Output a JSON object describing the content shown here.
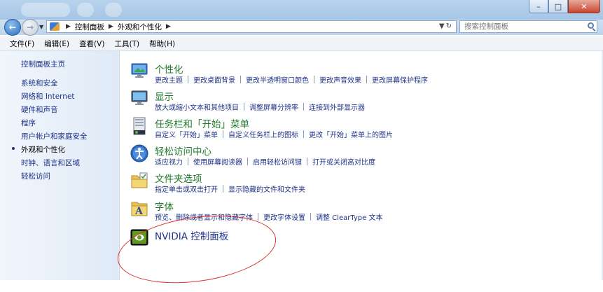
{
  "address": {
    "crumbs": [
      "控制面板",
      "外观和个性化"
    ]
  },
  "search": {
    "placeholder": "搜索控制面板"
  },
  "menu": [
    "文件(F)",
    "编辑(E)",
    "查看(V)",
    "工具(T)",
    "帮助(H)"
  ],
  "sidebar": {
    "home": "控制面板主页",
    "items": [
      "系统和安全",
      "网络和 Internet",
      "硬件和声音",
      "程序",
      "用户帐户和家庭安全",
      "外观和个性化",
      "时钟、语言和区域",
      "轻松访问"
    ],
    "active_index": 5
  },
  "categories": [
    {
      "title": "个性化",
      "icon": "personalization-icon",
      "links": [
        "更改主题",
        "更改桌面背景",
        "更改半透明窗口颜色",
        "更改声音效果",
        "更改屏幕保护程序"
      ]
    },
    {
      "title": "显示",
      "icon": "display-icon",
      "links": [
        "放大或缩小文本和其他项目",
        "调整屏幕分辨率",
        "连接到外部显示器"
      ]
    },
    {
      "title": "任务栏和「开始」菜单",
      "icon": "taskbar-icon",
      "links": [
        "自定义「开始」菜单",
        "自定义任务栏上的图标",
        "更改「开始」菜单上的图片"
      ]
    },
    {
      "title": "轻松访问中心",
      "icon": "ease-of-access-icon",
      "links": [
        "适应视力",
        "使用屏幕阅读器",
        "启用轻松访问键",
        "打开或关闭高对比度"
      ]
    },
    {
      "title": "文件夹选项",
      "icon": "folder-options-icon",
      "links": [
        "指定单击或双击打开",
        "显示隐藏的文件和文件夹"
      ]
    },
    {
      "title": "字体",
      "icon": "fonts-icon",
      "links": [
        "预览、删除或者显示和隐藏字体",
        "更改字体设置",
        "调整 ClearType 文本"
      ]
    },
    {
      "title": "NVIDIA 控制面板",
      "icon": "nvidia-icon",
      "links": []
    }
  ],
  "colors": {
    "link": "#1e3287",
    "category_title": "#1e7a2a",
    "annotation": "#d8322e"
  }
}
